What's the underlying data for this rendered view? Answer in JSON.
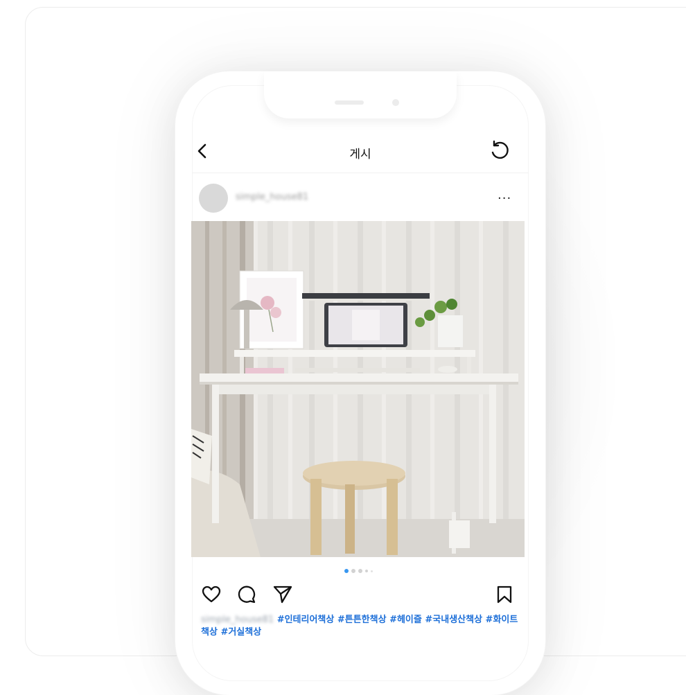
{
  "header": {
    "title": "게시",
    "back_icon": "chevron-left-icon",
    "refresh_icon": "refresh-icon"
  },
  "post": {
    "username": "simple_house81",
    "more_label": "···",
    "photo_description_icon": "desk-photo",
    "carousel": {
      "total": 5,
      "active_index": 0
    },
    "actions": {
      "like_icon": "heart-icon",
      "comment_icon": "comment-icon",
      "share_icon": "send-icon",
      "save_icon": "bookmark-icon"
    },
    "caption": {
      "username": "simple_house81",
      "hashtags": "#인테리어책상 #튼튼한책상 #헤이즐 #국내생산책상 #화이트책상 #거실책상"
    }
  },
  "colors": {
    "accent": "#3897f0",
    "hashtag": "#1d6fd8",
    "text": "#111111"
  }
}
